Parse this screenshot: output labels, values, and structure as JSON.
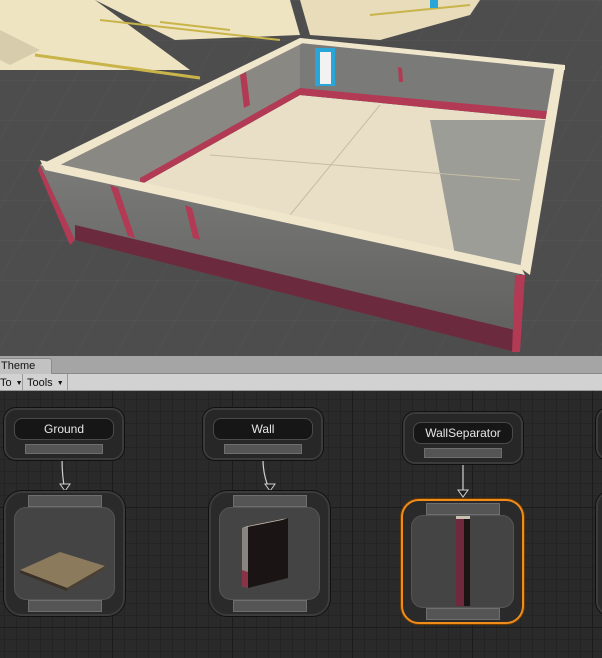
{
  "scene_viewport": {
    "background_color": "#4a4a4a",
    "wall_color": "#e8dfc6",
    "trim_color": "#b23a55",
    "door_color": "#2aa5d8"
  },
  "editor": {
    "tab_label": "Theme",
    "toolbar": {
      "left_cut_label": "To",
      "tools_label": "Tools"
    },
    "nodes": [
      {
        "id": "ground",
        "label": "Ground",
        "asset": "ground-tile"
      },
      {
        "id": "wall",
        "label": "Wall",
        "asset": "wall-segment"
      },
      {
        "id": "wall_separator",
        "label": "WallSeparator",
        "asset": "wall-separator-pillar",
        "selected": true
      }
    ],
    "selection_color": "#f08c1a"
  }
}
